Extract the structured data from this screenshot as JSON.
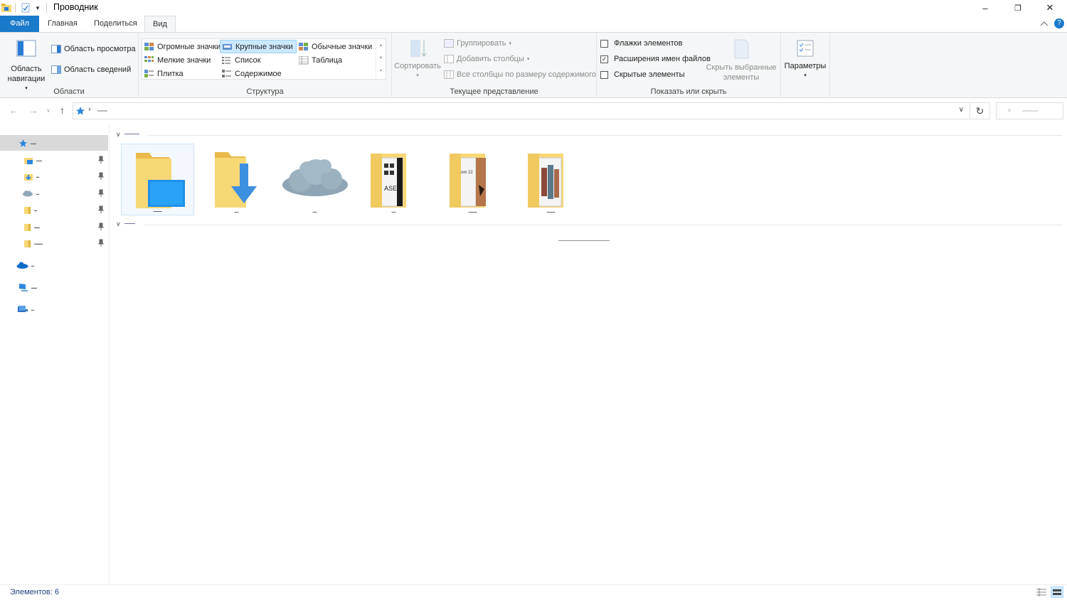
{
  "window": {
    "title": "Проводник",
    "minimize": "–",
    "restore": "❐",
    "close": "✕"
  },
  "tabs": [
    {
      "label": "Файл"
    },
    {
      "label": "Главная"
    },
    {
      "label": "Поделиться"
    },
    {
      "label": "Вид"
    }
  ],
  "ribbon": {
    "panes": {
      "nav_pane": "Область навигации",
      "preview_pane": "Область просмотра",
      "details_pane": "Область сведений",
      "group_label": "Области"
    },
    "layout": {
      "extra_large": "Огромные значки",
      "large": "Крупные значки",
      "medium": "Обычные значки",
      "small": "Мелкие значки",
      "list": "Список",
      "details": "Таблица",
      "tiles": "Плитка",
      "content": "Содержимое",
      "group_label": "Структура"
    },
    "current_view": {
      "sort": "Сортировать",
      "group_by": "Группировать",
      "add_columns": "Добавить столбцы",
      "size_columns": "Все столбцы по размеру содержимого",
      "group_label": "Текущее представление"
    },
    "show_hide": {
      "item_checkboxes": "Флажки элементов",
      "file_extensions": "Расширения имен файлов",
      "hidden_items": "Скрытые элементы",
      "hide_selected": "Скрыть выбранные элементы",
      "group_label": "Показать или скрыть",
      "checked": {
        "item_checkboxes": false,
        "file_extensions": true,
        "hidden_items": false
      }
    },
    "options": "Параметры"
  },
  "status": {
    "count": "Элементов: 6"
  },
  "colors": {
    "accent": "#1979ca",
    "folder": "#f8d775",
    "selection": "#cce8ff"
  }
}
